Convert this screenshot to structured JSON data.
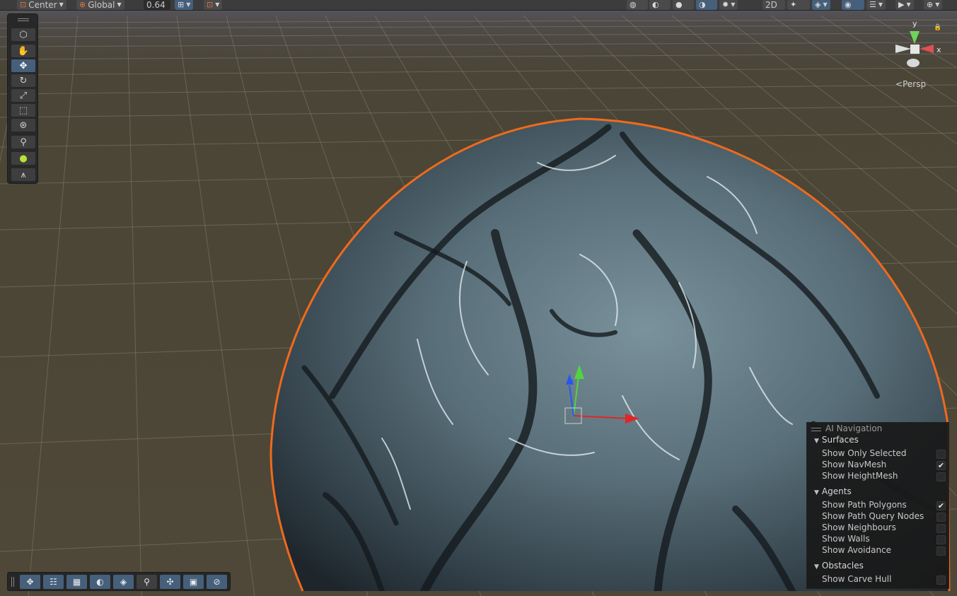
{
  "toolbar": {
    "pivot_mode": "Center",
    "pivot_rotation": "Global",
    "snap_increment": "0.64",
    "icons": [
      "pivot-icon",
      "globe-icon",
      "grid-snap-icon",
      "snap-settings-icon",
      "visibility-icon",
      "shading-icon",
      "2d-toggle-icon",
      "lighting-icon",
      "audio-icon",
      "effects-icon",
      "hidden-objects-icon",
      "layers-icon",
      "camera-icon",
      "gizmos-icon"
    ],
    "toggle_2d": "2D"
  },
  "tools": {
    "items": [
      "view-tool",
      "hand-tool",
      "move-tool",
      "rotate-tool",
      "scale-tool",
      "rect-tool",
      "transform-tool",
      "custom-tool",
      "navmesh-tool",
      "probe-tool"
    ],
    "active": "move-tool"
  },
  "gizmo": {
    "y_label": "y",
    "x_label": "x",
    "projection": "Persp"
  },
  "ai_navigation": {
    "title": "AI Navigation",
    "sections": [
      {
        "label": "Surfaces",
        "items": [
          {
            "label": "Show Only Selected",
            "checked": false
          },
          {
            "label": "Show NavMesh",
            "checked": true
          },
          {
            "label": "Show HeightMesh",
            "checked": false
          }
        ]
      },
      {
        "label": "Agents",
        "items": [
          {
            "label": "Show Path Polygons",
            "checked": true
          },
          {
            "label": "Show Path Query Nodes",
            "checked": false
          },
          {
            "label": "Show Neighbours",
            "checked": false
          },
          {
            "label": "Show Walls",
            "checked": false
          },
          {
            "label": "Show Avoidance",
            "checked": false
          }
        ]
      },
      {
        "label": "Obstacles",
        "items": [
          {
            "label": "Show Carve Hull",
            "checked": false
          }
        ]
      }
    ]
  },
  "colors": {
    "selection_outline": "#f06a1c",
    "axis_x": "#e02626",
    "axis_y": "#52d43f",
    "axis_z": "#2a56f0",
    "active_tool": "#46607c"
  }
}
